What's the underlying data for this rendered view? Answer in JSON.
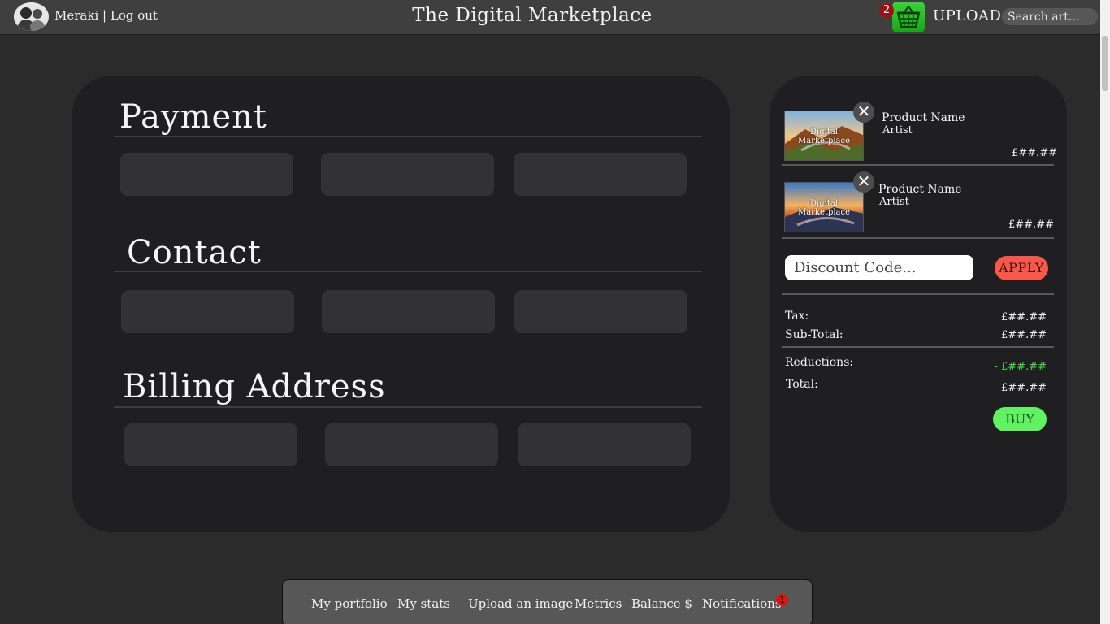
{
  "header": {
    "username": "Meraki",
    "separator": "|",
    "logout_label": "Log out",
    "site_title": "The Digital Marketplace",
    "cart_count": "2",
    "cart_icon": "basket-icon",
    "upload_label": "UPLOAD",
    "search_placeholder": "Search art..."
  },
  "form": {
    "sections": [
      {
        "title": "Payment"
      },
      {
        "title": "Contact"
      },
      {
        "title": "Billing Address"
      }
    ]
  },
  "cart": {
    "items": [
      {
        "name": "Product Name",
        "artist": "Artist",
        "price": "£##.##",
        "watermark": "Digital Marketplace",
        "remove_icon": "close-icon"
      },
      {
        "name": "Product Name",
        "artist": "Artist",
        "price": "£##.##",
        "watermark": "Digital Marketplace",
        "remove_icon": "close-icon"
      }
    ],
    "discount_placeholder": "Discount Code...",
    "apply_label": "APPLY",
    "tax_label": "Tax:",
    "tax_value": "£##.##",
    "subtotal_label": "Sub-Total:",
    "subtotal_value": "£##.##",
    "reductions_label": "Reductions:",
    "reductions_value": "- £##.##",
    "total_label": "Total:",
    "total_value": "£##.##",
    "buy_label": "BUY",
    "colors": {
      "apply": "#f8584b",
      "buy": "#61f261",
      "reduction": "#4ed64e"
    }
  },
  "bottom_nav": {
    "items": [
      "My portfolio",
      "My stats",
      "Upload an image",
      "Metrics",
      "Balance $",
      "Notifications"
    ],
    "notification_count": "1"
  }
}
